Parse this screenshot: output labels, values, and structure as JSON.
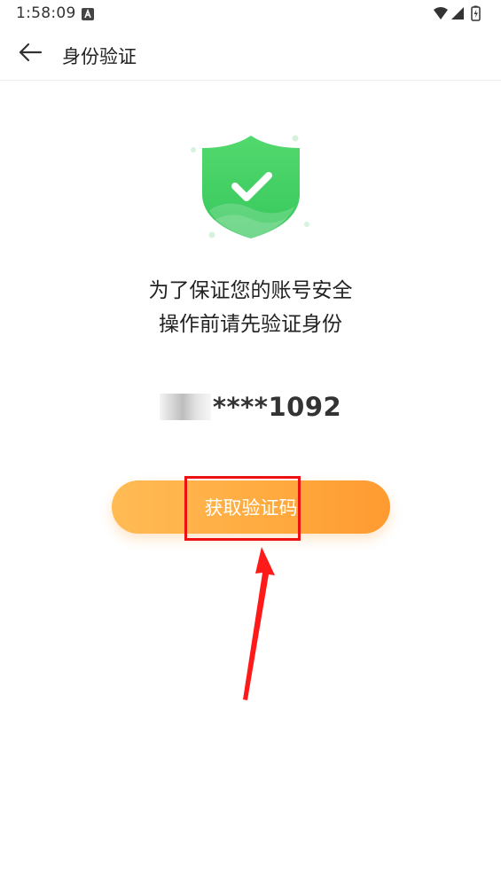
{
  "status_bar": {
    "time": "1:58:09",
    "icons": [
      "a-notification-icon",
      "wifi-icon",
      "signal-icon",
      "battery-icon"
    ]
  },
  "app_bar": {
    "back_icon": "arrow-left-icon",
    "title": "身份验证"
  },
  "content": {
    "shield_icon": "shield-check-icon",
    "message_line1": "为了保证您的账号安全",
    "message_line2": "操作前请先验证身份",
    "phone_suffix": "****1092",
    "button_label": "获取验证码"
  },
  "annotation": {
    "highlight_color": "#ee1111",
    "arrow_color": "#ff1a1a"
  },
  "colors": {
    "shield_green": "#3fd066",
    "button_start": "#ffbb55",
    "button_end": "#ff9a30"
  }
}
